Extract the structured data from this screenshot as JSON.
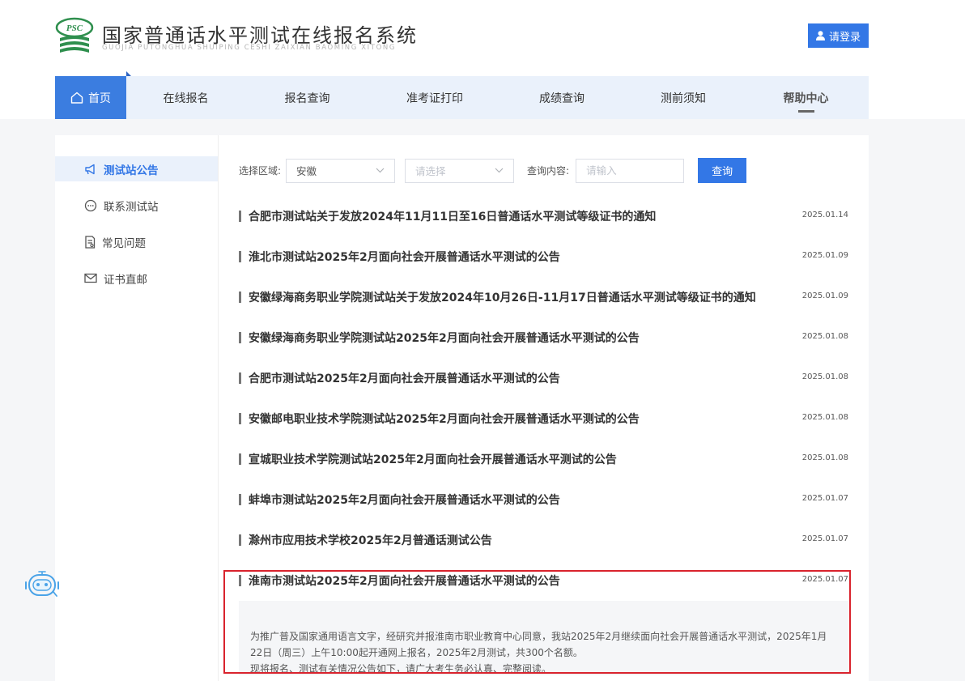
{
  "header": {
    "logo_mark_text": "PSC",
    "title": "国家普通话水平测试在线报名系统",
    "subtitle": "GUOJIA PUTONGHUA SHUIPING CESHI ZAIXIAN BAOMING XITONG",
    "login_label": "请登录",
    "brand_color": "#3377e6"
  },
  "nav": {
    "items": [
      {
        "label": "首页",
        "icon": "home-icon",
        "active": true
      },
      {
        "label": "在线报名"
      },
      {
        "label": "报名查询"
      },
      {
        "label": "准考证打印"
      },
      {
        "label": "成绩查询"
      },
      {
        "label": "测前须知"
      },
      {
        "label": "帮助中心",
        "emphasized": true
      }
    ]
  },
  "sidebar": {
    "items": [
      {
        "label": "测试站公告",
        "icon": "megaphone-icon",
        "active": true
      },
      {
        "label": "联系测试站",
        "icon": "chat-icon"
      },
      {
        "label": "常见问题",
        "icon": "document-icon"
      },
      {
        "label": "证书直邮",
        "icon": "mail-icon"
      }
    ]
  },
  "filters": {
    "region_label": "选择区域:",
    "region_value": "安徽",
    "city_placeholder": "请选择",
    "query_label": "查询内容:",
    "query_placeholder": "请输入",
    "query_button": "查询"
  },
  "notices": [
    {
      "title": "合肥市测试站关于发放2024年11月11日至16日普通话水平测试等级证书的通知",
      "date": "2025.01.14"
    },
    {
      "title": "淮北市测试站2025年2月面向社会开展普通话水平测试的公告",
      "date": "2025.01.09"
    },
    {
      "title": "安徽绿海商务职业学院测试站关于发放2024年10月26日-11月17日普通话水平测试等级证书的通知",
      "date": "2025.01.09"
    },
    {
      "title": "安徽绿海商务职业学院测试站2025年2月面向社会开展普通话水平测试的公告",
      "date": "2025.01.08"
    },
    {
      "title": "合肥市测试站2025年2月面向社会开展普通话水平测试的公告",
      "date": "2025.01.08"
    },
    {
      "title": "安徽邮电职业技术学院测试站2025年2月面向社会开展普通话水平测试的公告",
      "date": "2025.01.08"
    },
    {
      "title": "宣城职业技术学院测试站2025年2月面向社会开展普通话水平测试的公告",
      "date": "2025.01.08"
    },
    {
      "title": "蚌埠市测试站2025年2月面向社会开展普通话水平测试的公告",
      "date": "2025.01.07"
    },
    {
      "title": "滁州市应用技术学校2025年2月普通话测试公告",
      "date": "2025.01.07"
    },
    {
      "title": "淮南市测试站2025年2月面向社会开展普通话水平测试的公告",
      "date": "2025.01.07"
    }
  ],
  "excerpt": {
    "line1": "为推广普及国家通用语言文字，经研究并报淮南市职业教育中心同意，我站2025年2月继续面向社会开展普通话水平测试，2025年1月22日（周三）上午10:00起开通网上报名，2025年2月测试，共300个名额。",
    "line2": "现将报名、测试有关情况公告如下，请广大考生务必认真、完整阅读。"
  },
  "colors": {
    "highlight_border": "#d9232d",
    "nav_background": "#eaf1fb"
  }
}
